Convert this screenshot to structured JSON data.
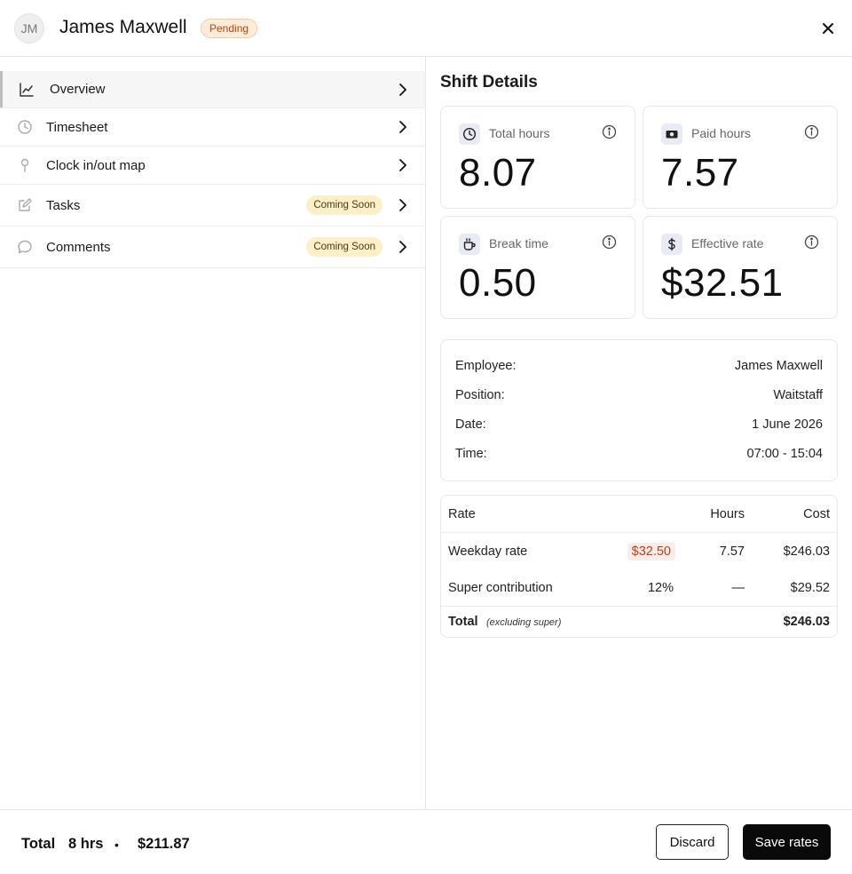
{
  "header": {
    "avatar_initials": "JM",
    "employee_name": "James Maxwell",
    "status": "Pending",
    "status_color": "#c2410c"
  },
  "sidebar": {
    "items": [
      {
        "label": "Overview",
        "icon": "chart-line-icon",
        "active": true,
        "badge": ""
      },
      {
        "label": "Timesheet",
        "icon": "clock-icon",
        "active": false,
        "badge": ""
      },
      {
        "label": "Clock in/out map",
        "icon": "map-pin-icon",
        "active": false,
        "badge": ""
      },
      {
        "label": "Tasks",
        "icon": "edit-icon",
        "active": false,
        "badge": "Coming Soon"
      },
      {
        "label": "Comments",
        "icon": "comment-icon",
        "active": false,
        "badge": "Coming Soon"
      }
    ]
  },
  "main": {
    "title": "Shift Details",
    "stats": [
      {
        "label": "Total hours",
        "value": "8.07",
        "icon": "clock-icon"
      },
      {
        "label": "Paid hours",
        "value": "7.57",
        "icon": "cash-icon"
      },
      {
        "label": "Break time",
        "value": "0.50",
        "icon": "coffee-icon"
      },
      {
        "label": "Effective rate",
        "value": "$32.51",
        "icon": "dollar-icon"
      }
    ],
    "details": [
      {
        "key": "Employee:",
        "value": "James Maxwell"
      },
      {
        "key": "Position:",
        "value": "Waitstaff"
      },
      {
        "key": "Date:",
        "value": "1 June 2026"
      },
      {
        "key": "Time:",
        "value": "07:00 - 15:04"
      }
    ],
    "rates": {
      "headers": {
        "rate": "Rate",
        "hours": "Hours",
        "cost": "Cost"
      },
      "rows": [
        {
          "name": "Weekday rate",
          "rate": "$32.50",
          "hours": "7.57",
          "cost": "$246.03"
        },
        {
          "name": "Super contribution",
          "rate": "12%",
          "hours": "—",
          "cost": "$29.52"
        }
      ],
      "total_label": "Total",
      "total_note": "(excluding super)",
      "total_cost": "$246.03"
    }
  },
  "footer": {
    "total_label": "Total",
    "hours": "8 hrs",
    "separator": "•",
    "amount": "$211.87",
    "discard_label": "Discard",
    "save_label": "Save rates"
  }
}
